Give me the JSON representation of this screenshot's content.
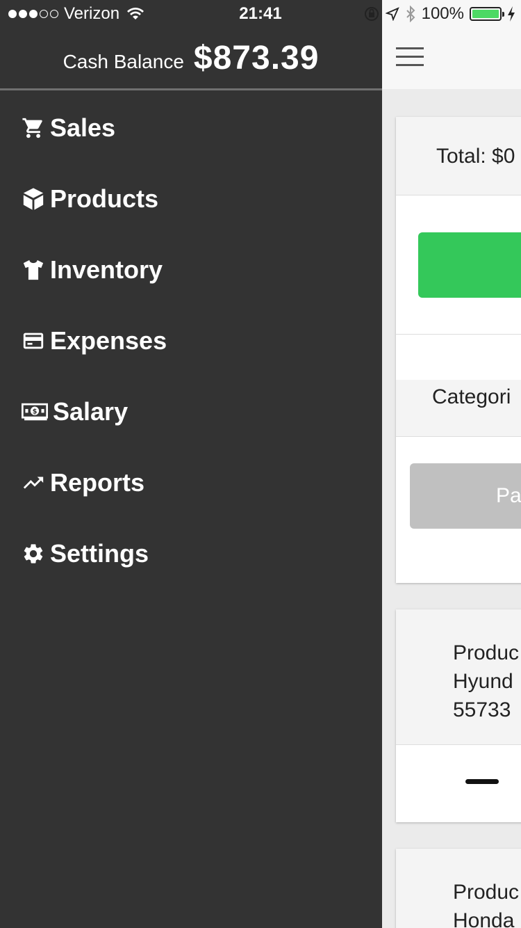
{
  "status_bar": {
    "carrier": "Verizon",
    "time": "21:41",
    "battery_percent": "100%"
  },
  "drawer": {
    "cash_balance_label": "Cash Balance",
    "cash_balance_value": "$873.39",
    "items": [
      {
        "label": "Sales",
        "icon": "cart-icon"
      },
      {
        "label": "Products",
        "icon": "cube-icon"
      },
      {
        "label": "Inventory",
        "icon": "tshirt-icon"
      },
      {
        "label": "Expenses",
        "icon": "credit-card-icon"
      },
      {
        "label": "Salary",
        "icon": "money-bill-icon"
      },
      {
        "label": "Reports",
        "icon": "trending-up-icon"
      },
      {
        "label": "Settings",
        "icon": "gear-icon"
      }
    ]
  },
  "main": {
    "total_label": "Total: $0",
    "categories_label": "Categori",
    "pay_button_label": "Pa",
    "product_card_1": {
      "line1": "Produc",
      "line2": "Hyund",
      "line3": "55733"
    },
    "product_card_2": {
      "line1": "Produc",
      "line2": "Honda"
    }
  },
  "colors": {
    "drawer_bg": "#333333",
    "green_button": "#34c85a",
    "grey_button": "#c0c0c0"
  }
}
